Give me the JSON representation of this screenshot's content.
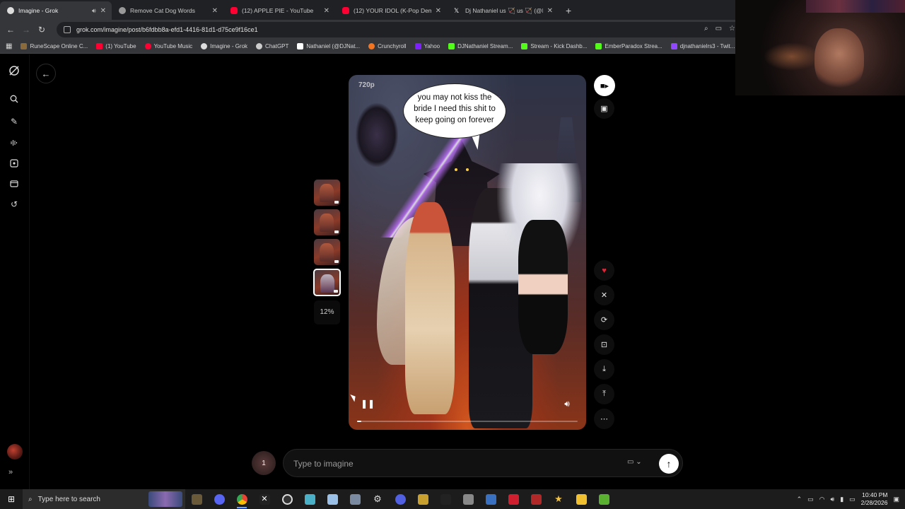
{
  "browser": {
    "tabs": [
      {
        "title": "Imagine - Grok",
        "active": true,
        "favicon_color": "#dddddd"
      },
      {
        "title": "Remove Cat Dog Words",
        "active": false,
        "favicon_color": "#bbbbbb"
      },
      {
        "title": "(12) APPLE PIE - YouTube",
        "active": false,
        "favicon_color": "#ff0033"
      },
      {
        "title": "(12) YOUR IDOL (K-Pop Demon",
        "active": false,
        "favicon_color": "#ff0033"
      },
      {
        "title": "Dj Nathaniel us 🏹 us 🏹 (@DJN",
        "active": false,
        "favicon_color": "#ffffff"
      }
    ],
    "url": "grok.com/imagine/post/b6fdbb8a-efd1-4416-81d1-d75ce9f16ce1",
    "bookmarks": [
      {
        "label": "RuneScape Online C...",
        "color": "#8a6a3a"
      },
      {
        "label": "(1) YouTube",
        "color": "#ff0033"
      },
      {
        "label": "YouTube Music",
        "color": "#ff0033"
      },
      {
        "label": "Imagine - Grok",
        "color": "#dddddd"
      },
      {
        "label": "ChatGPT",
        "color": "#cccccc"
      },
      {
        "label": "Nathaniel (@DJNat...",
        "color": "#ffffff"
      },
      {
        "label": "Crunchyroll",
        "color": "#f47521"
      },
      {
        "label": "Yahoo",
        "color": "#7e1fff"
      },
      {
        "label": "DJNathaniel Stream...",
        "color": "#53fc18"
      },
      {
        "label": "Stream - Kick Dashb...",
        "color": "#53fc18"
      },
      {
        "label": "EmberParadox Strea...",
        "color": "#53fc18"
      },
      {
        "label": "djnathanielrs3 - Twit...",
        "color": "#9146ff"
      }
    ]
  },
  "sidebar": {
    "icons": [
      "grok-logo-icon",
      "search-icon",
      "edit-icon",
      "voice-icon",
      "imagine-icon",
      "folder-icon",
      "history-icon"
    ]
  },
  "viewer": {
    "resolution": "720p",
    "speech_bubble": "you may not kiss the bride I need this shit to keep going on forever",
    "progress_label": "12%",
    "playback_fraction": 0.02,
    "thumbnails": 4,
    "selected_thumbnail": 4
  },
  "composer": {
    "placeholder": "Type to imagine",
    "attachment_count": "1"
  },
  "taskbar": {
    "search_placeholder": "Type here to search",
    "time": "10:40 PM",
    "date": "2/28/2026"
  },
  "colors": {
    "accent_like": "#e0283c",
    "background": "#000000"
  }
}
